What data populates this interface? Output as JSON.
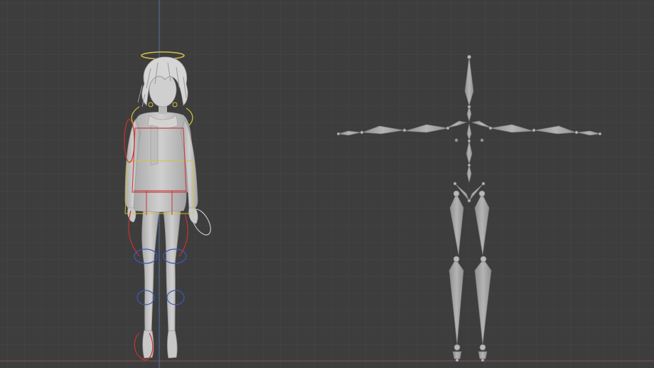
{
  "viewport": {
    "background": "#3d3d3d",
    "grid_minor_color": "#454545",
    "grid_major_color": "#4a4a4a",
    "axis_y_color": "#5a7fbf",
    "axis_x_color": "#b85a5a"
  },
  "scene": {
    "character_mesh": {
      "color": "#c4c4c4",
      "shadow": "#9a9a9a"
    },
    "halo": {
      "color": "#d4c24a"
    },
    "controls": {
      "yellow": "#d2c33c",
      "red": "#c83232",
      "blue": "#3c5ab4",
      "white": "#c8c8c8"
    },
    "armature": {
      "color": "#a8a8a8",
      "edge": "#7a7a7a",
      "joint": "#b8b8b8"
    }
  }
}
